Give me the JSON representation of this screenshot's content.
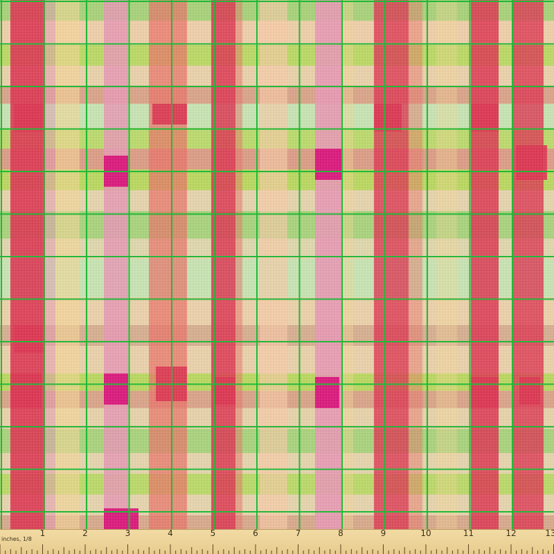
{
  "ruler": {
    "unit_label": "inches, 1/8",
    "numbers": [
      "1",
      "2",
      "3",
      "4",
      "5",
      "6",
      "7",
      "8",
      "9",
      "10",
      "11",
      "12",
      "13"
    ]
  },
  "colors": {
    "background": "#c7e2b3",
    "grid_line": "#22b83a",
    "ruler": "#efd79e",
    "red": "#dc3a55",
    "coral": "#e8726a",
    "pink": "#e59ab4",
    "magenta": "#d8127a",
    "peach": "#f6c9a8",
    "lime": "#b8d65a",
    "green": "#a5cf75",
    "orange": "#e98a4e",
    "yellow": "#f3d697"
  }
}
